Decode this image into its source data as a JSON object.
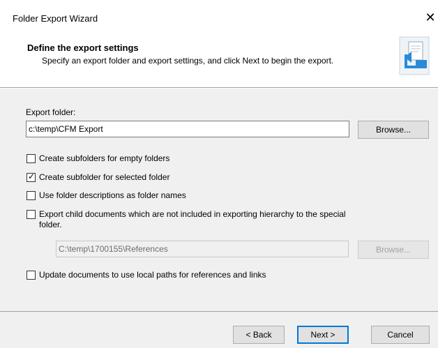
{
  "window": {
    "title": "Folder Export Wizard",
    "close_glyph": "✕"
  },
  "header": {
    "title": "Define the export settings",
    "subtitle": "Specify an export folder and export settings, and click Next to begin the export.",
    "icon": "export-wizard-icon"
  },
  "export_folder": {
    "label": "Export folder:",
    "value": "c:\\temp\\CFM Export",
    "browse_label": "Browse..."
  },
  "options": [
    {
      "label": "Create subfolders for empty folders",
      "checked": false
    },
    {
      "label": "Create subfolder for selected folder",
      "checked": true
    },
    {
      "label": "Use folder descriptions as folder names",
      "checked": false
    },
    {
      "label": "Export child documents which are not included in exporting hierarchy to the special folder.",
      "checked": false
    }
  ],
  "special_folder": {
    "value": "C:\\temp\\1700155\\References",
    "browse_label": "Browse...",
    "enabled": false
  },
  "update_docs": {
    "label": "Update documents to use local paths for references and links",
    "checked": false
  },
  "footer": {
    "back_label": "< Back",
    "next_label": "Next >",
    "cancel_label": "Cancel"
  },
  "colors": {
    "dialog_bg": "#f0f0f0",
    "header_bg": "#ffffff",
    "accent": "#0078d7"
  }
}
